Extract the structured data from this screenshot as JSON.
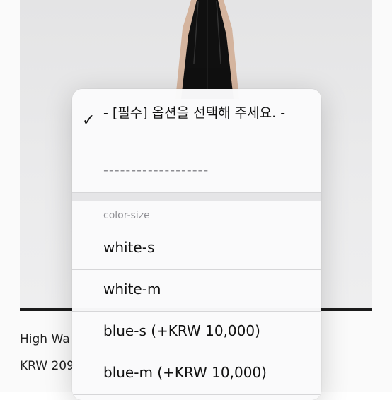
{
  "product": {
    "name": "High Wa",
    "price": "KRW 209"
  },
  "picker": {
    "selected_label": "- [필수] 옵션을 선택해 주세요. -",
    "check_glyph": "✓",
    "divider_label": "-------------------",
    "group_label": "color-size",
    "options": [
      "white-s",
      "white-m",
      "blue-s (+KRW 10,000)",
      "blue-m (+KRW 10,000)"
    ]
  },
  "icons": {
    "check": "checkmark-icon"
  }
}
